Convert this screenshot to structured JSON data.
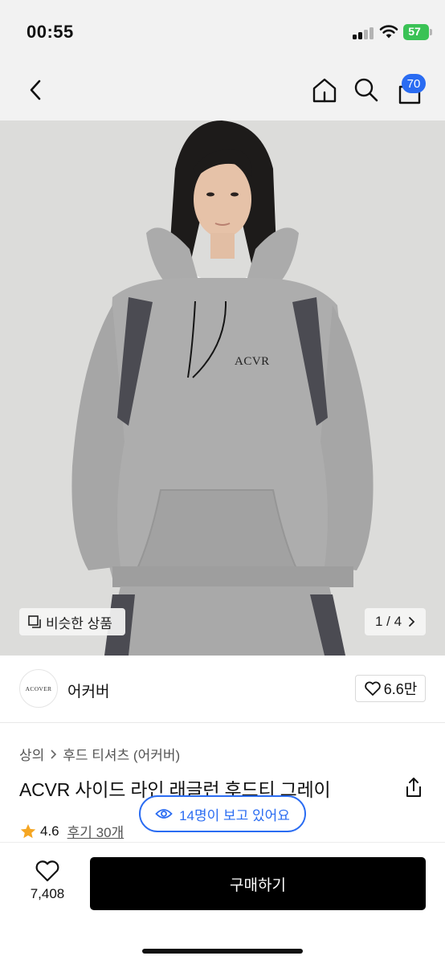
{
  "status": {
    "time": "00:55",
    "battery": "57"
  },
  "nav": {
    "cart_count": "70"
  },
  "image": {
    "garment_print": "ACVR",
    "similar_label": "비슷한 상품",
    "pager": "1 / 4"
  },
  "brand": {
    "logo_text": "ACOVER",
    "name": "어커버",
    "likes": "6.6만"
  },
  "breadcrumb": {
    "level1": "상의",
    "level2": "후드 티셔츠 (어커버)"
  },
  "product": {
    "title": "ACVR 사이드 라인 래글런 후드티 그레이",
    "rating": "4.6",
    "reviews": "후기 30개"
  },
  "viewers": {
    "text": "14명이 보고 있어요"
  },
  "bottom": {
    "wish_count": "7,408",
    "buy_label": "구매하기"
  },
  "colors": {
    "accent": "#2a6cf2",
    "battery": "#3ac255",
    "star": "#f5a623",
    "buy_bg": "#000000"
  }
}
